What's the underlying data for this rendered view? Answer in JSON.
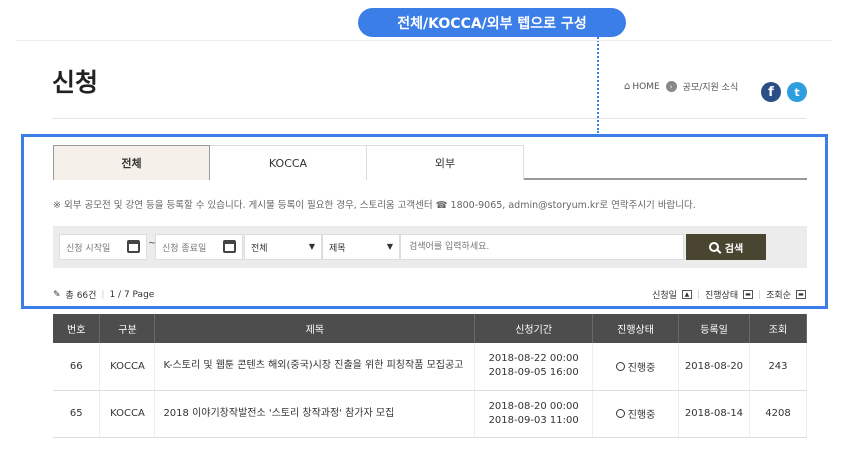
{
  "annotation": {
    "callout": "전체/KOCCA/외부 텝으로 구성"
  },
  "page": {
    "title": "신청"
  },
  "breadcrumb": {
    "home": "HOME",
    "item": "공모/지원 소식"
  },
  "sns": {
    "facebook": "f",
    "twitter": "t"
  },
  "tabs": [
    {
      "label": "전체",
      "active": true
    },
    {
      "label": "KOCCA",
      "active": false
    },
    {
      "label": "외부",
      "active": false
    }
  ],
  "notice": "※ 외부 공모전 및 강연 등을 등록할 수 있습니다. 게시물 등록이 필요한 경우, 스토리움 고객센터 ☎ 1800-9065, admin@storyum.kr로 연락주시기 바랍니다.",
  "search": {
    "start_date": "신청 시작일",
    "tilde": "~",
    "end_date": "신청 종료일",
    "category": "전체",
    "field": "제목",
    "keyword_placeholder": "검색어를 입력하세요.",
    "button": "검색"
  },
  "stats": {
    "total": "총 66건",
    "sep": "|",
    "page": "1 / 7 Page"
  },
  "sorts": {
    "by_date": "신청일",
    "by_status": "진행상태",
    "by_views": "조회순",
    "sep": "|"
  },
  "table": {
    "headers": [
      "번호",
      "구분",
      "제목",
      "신청기간",
      "진행상태",
      "등록일",
      "조회"
    ],
    "rows": [
      {
        "no": "66",
        "type": "KOCCA",
        "title": "K-스토리 및 웹툰 콘텐츠 해외(중국)시장 진출을 위한 피칭작품 모집공고",
        "start": "2018-08-22 00:00",
        "end": "2018-09-05 16:00",
        "status": "진행중",
        "date": "2018-08-20",
        "views": "243"
      },
      {
        "no": "65",
        "type": "KOCCA",
        "title": "2018 이야기창작발전소 '스토리 창작과정' 참가자 모집",
        "start": "2018-08-20 00:00",
        "end": "2018-09-03 11:00",
        "status": "진행중",
        "date": "2018-08-14",
        "views": "4208"
      }
    ]
  },
  "colors": {
    "accent": "#3c7ee8",
    "button": "#4a4530",
    "table_header": "#4d4d4d"
  }
}
